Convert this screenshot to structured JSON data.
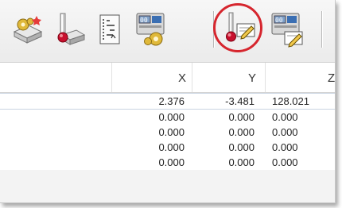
{
  "accent": {
    "highlight": "#d6262e",
    "probe_tip": "#c8102e"
  },
  "toolbar": {
    "buttons": [
      {
        "icon": "machine-setup-icon"
      },
      {
        "icon": "probe-icon"
      },
      {
        "icon": "step-list-icon"
      },
      {
        "icon": "machine-display-gear-icon"
      },
      {
        "icon": "probe-edit-icon",
        "highlighted": true
      },
      {
        "icon": "machine-display-edit-icon"
      }
    ]
  },
  "table": {
    "headers": {
      "x": "X",
      "y": "Y",
      "z": "Z"
    },
    "rows": [
      {
        "x": "2.376",
        "y": "-3.481",
        "z": "128.021"
      },
      {
        "x": "0.000",
        "y": "0.000",
        "z": "0.000"
      },
      {
        "x": "0.000",
        "y": "0.000",
        "z": "0.000"
      },
      {
        "x": "0.000",
        "y": "0.000",
        "z": "0.000"
      },
      {
        "x": "0.000",
        "y": "0.000",
        "z": "0.000"
      }
    ]
  }
}
